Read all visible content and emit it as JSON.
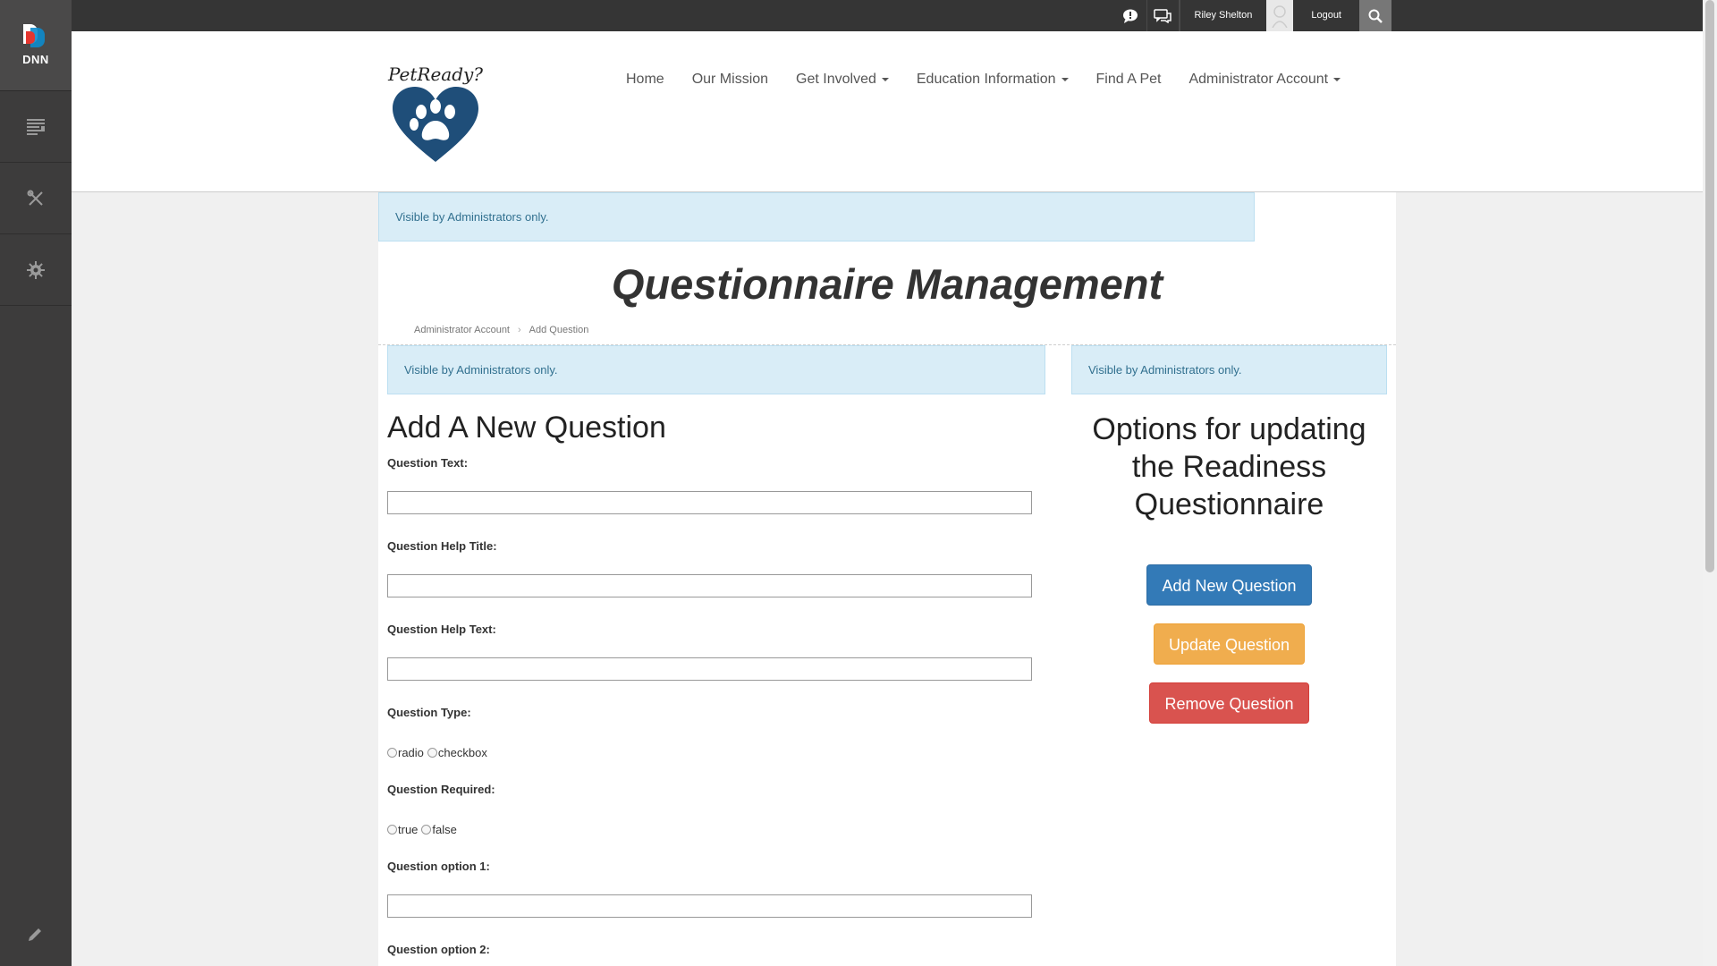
{
  "persona_bar": {
    "logo_text": "DNN",
    "items": [
      "content-icon",
      "tools-icon",
      "settings-icon"
    ],
    "edit_icon": "pencil-icon"
  },
  "topbar": {
    "user_name": "Riley Shelton",
    "logout": "Logout"
  },
  "header": {
    "brand": "PetReady?",
    "nav": [
      {
        "label": "Home",
        "dropdown": false
      },
      {
        "label": "Our Mission",
        "dropdown": false
      },
      {
        "label": "Get Involved",
        "dropdown": true
      },
      {
        "label": "Education Information",
        "dropdown": true
      },
      {
        "label": "Find A Pet",
        "dropdown": false
      },
      {
        "label": "Administrator Account",
        "dropdown": true
      }
    ]
  },
  "notices": {
    "top": "Visible by Administrators only.",
    "left": "Visible by Administrators only.",
    "right": "Visible by Administrators only."
  },
  "page": {
    "title": "Questionnaire Management",
    "breadcrumb": [
      "Administrator Account",
      "Add Question"
    ]
  },
  "form": {
    "heading": "Add A New Question",
    "question_text_label": "Question Text:",
    "help_title_label": "Question Help Title:",
    "help_text_label": "Question Help Text:",
    "type_label": "Question Type:",
    "type_options": [
      "radio",
      "checkbox"
    ],
    "required_label": "Question Required:",
    "required_options": [
      "true",
      "false"
    ],
    "option1_label": "Question option 1:",
    "option2_label": "Question option 2:"
  },
  "sidebar": {
    "heading": "Options for updating the Readiness Questionnaire",
    "add_button": "Add New Question",
    "update_button": "Update Question",
    "remove_button": "Remove Question"
  },
  "colors": {
    "primary": "#337ab7",
    "warning": "#f0ad4e",
    "danger": "#d9534f",
    "info_bg": "#d9edf7",
    "brand_heart": "#1f4e79"
  }
}
